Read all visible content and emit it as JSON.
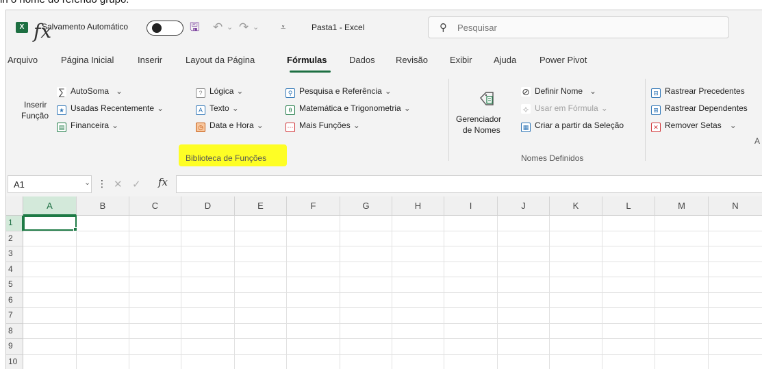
{
  "caption": "in o nome do referido grupo:",
  "titlebar": {
    "app_icon": "X",
    "autosave_label": "Salvamento Automático",
    "autosave_state": "off",
    "save_icon": "save-icon",
    "undo_icon": "undo-icon",
    "redo_icon": "redo-icon",
    "customize_icon": "customize-quick-access-icon",
    "document_title": "Pasta1  -  Excel",
    "search_placeholder": "Pesquisar"
  },
  "tabs": [
    {
      "label": "Arquivo"
    },
    {
      "label": "Página Inicial"
    },
    {
      "label": "Inserir"
    },
    {
      "label": "Layout da Página"
    },
    {
      "label": "Fórmulas",
      "active": true
    },
    {
      "label": "Dados"
    },
    {
      "label": "Revisão"
    },
    {
      "label": "Exibir"
    },
    {
      "label": "Ajuda"
    },
    {
      "label": "Power Pivot"
    }
  ],
  "ribbon": {
    "insert_function": {
      "line1": "Inserir",
      "line2": "Função"
    },
    "library": {
      "autosum": "AutoSoma",
      "recent": "Usadas Recentemente",
      "financial": "Financeira",
      "logical": "Lógica",
      "text": "Texto",
      "datetime": "Data e Hora",
      "lookup": "Pesquisa e Referência",
      "math": "Matemática e Trigonometria",
      "more": "Mais Funções",
      "group_label": "Biblioteca de Funções"
    },
    "names": {
      "manager_line1": "Gerenciador",
      "manager_line2": "de Nomes",
      "define_name": "Definir Nome",
      "use_in_formula": "Usar em Fórmula",
      "create_from_selection": "Criar a partir da Seleção",
      "group_label": "Nomes Definidos"
    },
    "auditing": {
      "trace_precedents": "Rastrear Precedentes",
      "trace_dependents": "Rastrear Dependentes",
      "remove_arrows": "Remover Setas",
      "group_label_partial": "A"
    },
    "highlight_color": "#ffff00"
  },
  "formula_bar": {
    "name_box": "A1",
    "formula_value": ""
  },
  "grid": {
    "columns": [
      "A",
      "B",
      "C",
      "D",
      "E",
      "F",
      "G",
      "H",
      "I",
      "J",
      "K",
      "L",
      "M",
      "N"
    ],
    "rows": [
      "1",
      "2",
      "3",
      "4",
      "5",
      "6",
      "7",
      "8",
      "9",
      "10"
    ],
    "active_cell": "A1",
    "accent": "#1d7a45"
  }
}
